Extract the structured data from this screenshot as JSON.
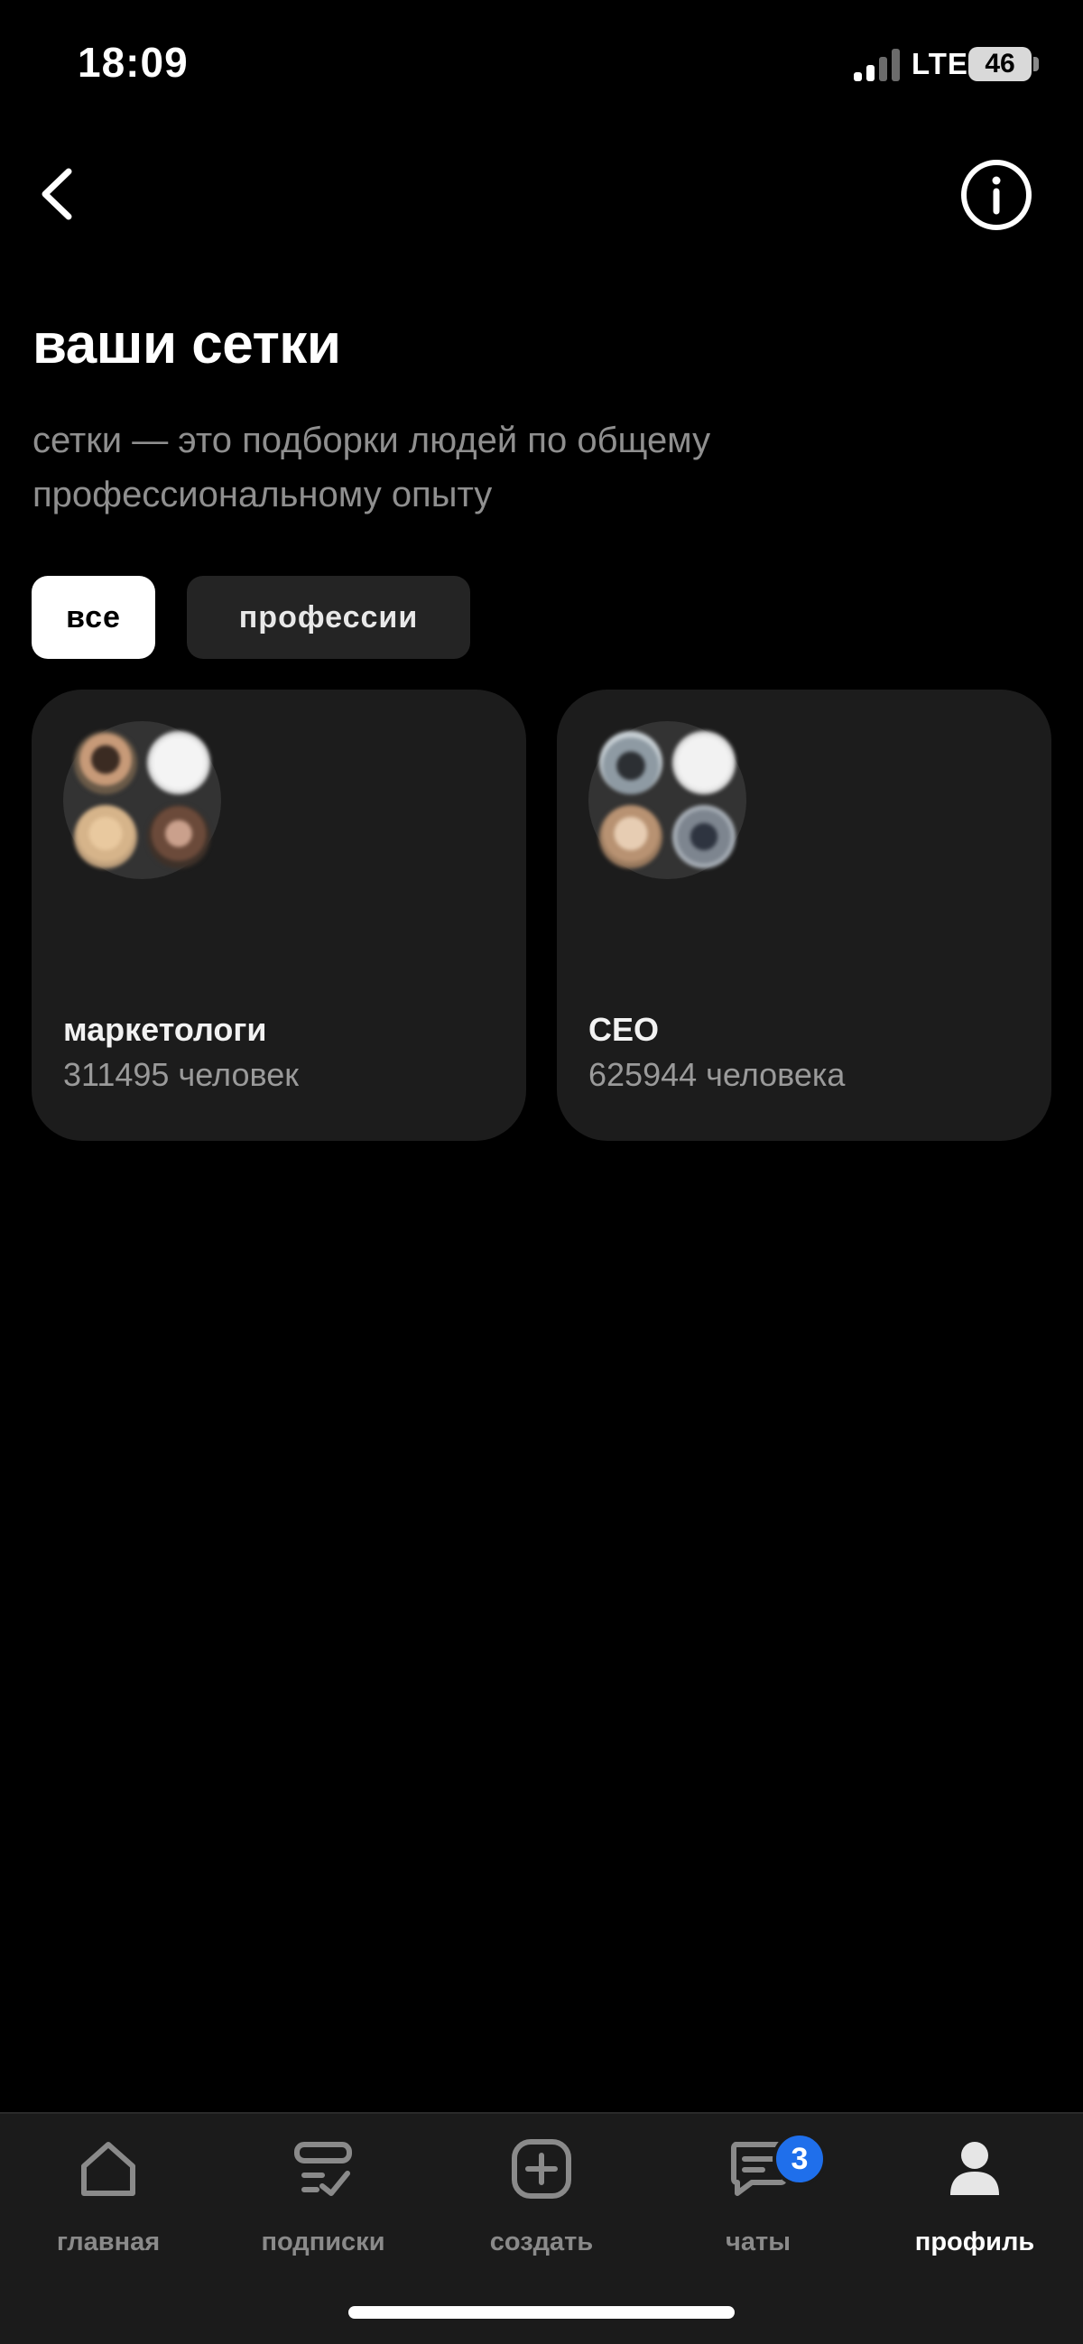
{
  "status_bar": {
    "time": "18:09",
    "network": "LTE",
    "battery": "46"
  },
  "header": {
    "title": "ваши сетки",
    "subtitle": "сетки — это подборки людей по общему профессиональному опыту"
  },
  "filters": [
    {
      "label": "все",
      "selected": true
    },
    {
      "label": "профессии",
      "selected": false
    }
  ],
  "cards": [
    {
      "title": "маркетологи",
      "count": "311495 человек"
    },
    {
      "title": "CEO",
      "count": "625944 человека"
    }
  ],
  "tab_bar": {
    "items": [
      {
        "label": "главная",
        "icon": "home-icon"
      },
      {
        "label": "подписки",
        "icon": "subscriptions-icon"
      },
      {
        "label": "создать",
        "icon": "create-plus-icon"
      },
      {
        "label": "чаты",
        "icon": "chat-icon",
        "badge": "3"
      },
      {
        "label": "профиль",
        "icon": "profile-icon",
        "active": true
      }
    ]
  },
  "colors": {
    "background": "#000000",
    "card": "#1c1c1c",
    "badge": "#1f6feb",
    "muted_text": "#8f8f8f"
  }
}
